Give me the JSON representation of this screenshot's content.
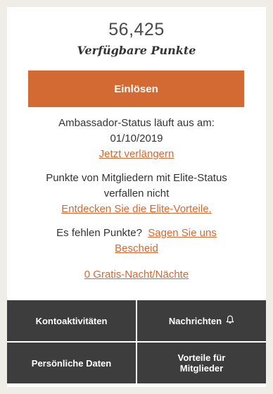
{
  "points": {
    "value": "56,425",
    "label": "Verfügbare Punkte"
  },
  "redeem_button": "Einlösen",
  "ambassador": {
    "line1": "Ambassador-Status läuft aus am:",
    "date": "01/10/2019",
    "extend_link": "Jetzt verlängern"
  },
  "elite": {
    "line1": "Punkte von Mitgliedern mit Elite-Status",
    "line2": "verfallen nicht",
    "link": "Entdecken Sie die Elite-Vorteile."
  },
  "missing": {
    "question": "Es fehlen Punkte?",
    "link_part1": "Sagen Sie uns",
    "link_part2": "Bescheid"
  },
  "free_nights_link": "0 Gratis-Nacht/Nächte",
  "tiles": {
    "account_activity": "Kontoaktivitäten",
    "messages": "Nachrichten",
    "personal_data": "Persönliche Daten",
    "member_benefits_line1": "Vorteile für",
    "member_benefits_line2": "Mitglieder"
  },
  "colors": {
    "accent": "#d46a33",
    "tile_bg": "#3d3d3d",
    "page_bg": "#f0ece6"
  },
  "icons": {
    "messages": "bell-icon"
  }
}
